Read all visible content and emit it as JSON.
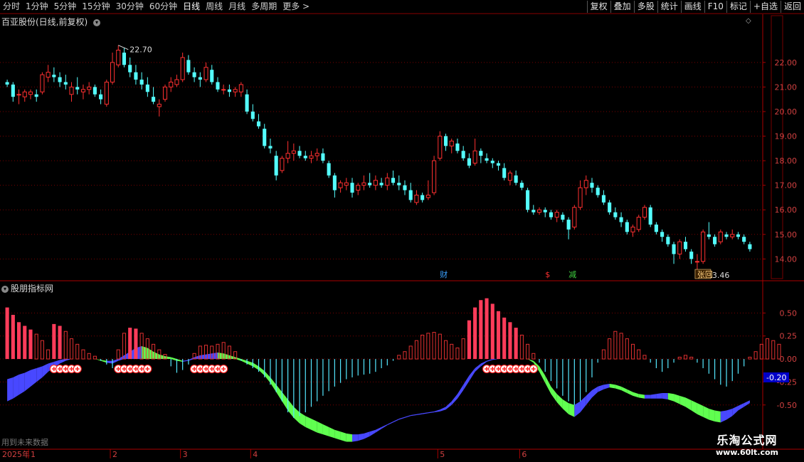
{
  "toolbar": {
    "periods": [
      "分时",
      "1分钟",
      "5分钟",
      "15分钟",
      "30分钟",
      "60分钟",
      "日线",
      "周线",
      "月线",
      "多周期",
      "更多 >"
    ],
    "active_period": "日线",
    "tools": [
      "复权",
      "叠加",
      "多股",
      "统计",
      "画线",
      "F10",
      "标记",
      "+自选",
      "返回"
    ]
  },
  "main_pane": {
    "title": "百亚股份(日线,前复权)",
    "high_label": "22.70",
    "low_label": "13.46",
    "markers": [
      {
        "text": "财",
        "color": "#3aa0ff"
      },
      {
        "text": "$",
        "color": "#ff3030"
      },
      {
        "text": "减",
        "color": "#40d040"
      },
      {
        "text": "张回",
        "color": "#ffd080"
      }
    ],
    "y_ticks": [
      "22.00",
      "21.00",
      "20.00",
      "19.00",
      "18.00",
      "17.00",
      "16.00",
      "15.00",
      "14.00"
    ]
  },
  "indicator_pane": {
    "title": "股朋指标网",
    "y_ticks": [
      "0.50",
      "0.25",
      "0.00",
      "-0.25",
      "-0.50"
    ],
    "current_value": "-0.20",
    "footer_note": "用到未来数据"
  },
  "x_axis": {
    "labels": [
      "2025年",
      "1",
      "2",
      "3",
      "4",
      "5",
      "6"
    ]
  },
  "watermark": {
    "line1": "乐淘公式网",
    "line2": "www.60lt.com"
  },
  "colors": {
    "up": "#ff3030",
    "down": "#54ffff",
    "hist_pos": "#ff3c5a",
    "hist_neg": "#54e8ff",
    "band_blue": "#4848ff",
    "band_green": "#60ff50"
  },
  "chart_data": {
    "type": "candlestick",
    "ylim": [
      13.2,
      23.5
    ],
    "candles": [
      [
        21.2,
        21.3,
        21.0,
        21.1
      ],
      [
        21.1,
        21.2,
        20.4,
        20.6
      ],
      [
        20.7,
        20.9,
        20.3,
        20.7
      ],
      [
        20.6,
        20.9,
        20.4,
        20.8
      ],
      [
        20.7,
        20.9,
        20.5,
        20.8
      ],
      [
        20.7,
        20.9,
        20.4,
        20.6
      ],
      [
        20.8,
        21.6,
        20.7,
        21.5
      ],
      [
        21.4,
        21.9,
        21.2,
        21.6
      ],
      [
        21.5,
        21.8,
        21.2,
        21.4
      ],
      [
        21.4,
        21.6,
        21.0,
        21.2
      ],
      [
        21.2,
        21.5,
        20.9,
        21.1
      ],
      [
        20.7,
        21.2,
        20.4,
        21.0
      ],
      [
        21.0,
        21.4,
        20.7,
        20.9
      ],
      [
        20.8,
        21.1,
        20.5,
        20.9
      ],
      [
        20.9,
        21.2,
        20.7,
        21.0
      ],
      [
        21.0,
        21.1,
        20.6,
        20.7
      ],
      [
        20.7,
        20.9,
        20.3,
        20.5
      ],
      [
        20.3,
        21.3,
        20.2,
        21.2
      ],
      [
        21.2,
        22.4,
        21.1,
        22.0
      ],
      [
        21.9,
        22.7,
        21.8,
        22.5
      ],
      [
        22.4,
        22.6,
        21.8,
        21.9
      ],
      [
        21.9,
        22.2,
        21.4,
        21.6
      ],
      [
        21.6,
        21.9,
        21.1,
        21.3
      ],
      [
        21.3,
        21.6,
        20.9,
        21.1
      ],
      [
        21.1,
        21.4,
        20.6,
        20.8
      ],
      [
        20.6,
        21.0,
        20.3,
        20.4
      ],
      [
        20.2,
        20.5,
        19.8,
        20.3
      ],
      [
        20.5,
        21.1,
        20.4,
        21.0
      ],
      [
        21.0,
        21.4,
        20.8,
        21.2
      ],
      [
        21.1,
        21.5,
        21.0,
        21.3
      ],
      [
        21.3,
        22.4,
        21.2,
        22.2
      ],
      [
        22.1,
        22.3,
        21.5,
        21.6
      ],
      [
        21.6,
        21.8,
        21.2,
        21.4
      ],
      [
        21.4,
        21.6,
        21.0,
        21.3
      ],
      [
        21.3,
        22.0,
        21.2,
        21.8
      ],
      [
        21.7,
        21.9,
        21.1,
        21.2
      ],
      [
        21.2,
        21.4,
        20.8,
        20.9
      ],
      [
        20.9,
        21.1,
        20.7,
        20.9
      ],
      [
        20.9,
        21.1,
        20.6,
        20.8
      ],
      [
        20.8,
        21.0,
        20.6,
        20.9
      ],
      [
        20.8,
        21.2,
        20.6,
        21.1
      ],
      [
        20.7,
        20.9,
        19.9,
        20.0
      ],
      [
        20.0,
        20.3,
        19.6,
        19.7
      ],
      [
        19.6,
        19.9,
        19.3,
        19.4
      ],
      [
        19.3,
        19.5,
        18.5,
        18.6
      ],
      [
        18.6,
        18.9,
        18.3,
        18.5
      ],
      [
        18.2,
        18.4,
        17.2,
        17.4
      ],
      [
        17.6,
        18.2,
        17.5,
        18.1
      ],
      [
        18.1,
        18.8,
        17.9,
        18.3
      ],
      [
        18.3,
        18.7,
        18.0,
        18.4
      ],
      [
        18.4,
        18.6,
        18.1,
        18.2
      ],
      [
        18.2,
        18.4,
        18.0,
        18.1
      ],
      [
        18.1,
        18.4,
        17.9,
        18.2
      ],
      [
        18.2,
        18.5,
        18.0,
        18.3
      ],
      [
        18.3,
        18.5,
        17.9,
        18.0
      ],
      [
        17.9,
        18.0,
        17.3,
        17.4
      ],
      [
        17.4,
        17.5,
        16.5,
        16.8
      ],
      [
        16.9,
        17.2,
        16.7,
        17.1
      ],
      [
        17.0,
        17.3,
        16.8,
        17.1
      ],
      [
        17.1,
        17.3,
        16.5,
        16.7
      ],
      [
        16.8,
        17.1,
        16.6,
        17.0
      ],
      [
        17.0,
        17.4,
        16.8,
        17.1
      ],
      [
        17.1,
        17.5,
        16.9,
        17.0
      ],
      [
        17.0,
        17.4,
        16.8,
        17.2
      ],
      [
        17.1,
        17.3,
        16.9,
        17.0
      ],
      [
        17.0,
        17.5,
        16.8,
        17.3
      ],
      [
        17.3,
        17.6,
        17.0,
        17.1
      ],
      [
        17.1,
        17.4,
        16.8,
        17.0
      ],
      [
        17.0,
        17.2,
        16.6,
        16.8
      ],
      [
        16.8,
        17.1,
        16.3,
        16.4
      ],
      [
        16.3,
        16.8,
        16.2,
        16.6
      ],
      [
        16.6,
        16.7,
        16.3,
        16.4
      ],
      [
        16.5,
        17.2,
        16.4,
        16.6
      ],
      [
        16.7,
        18.2,
        16.6,
        18.0
      ],
      [
        18.1,
        19.2,
        18.0,
        19.0
      ],
      [
        19.0,
        19.1,
        18.4,
        18.6
      ],
      [
        18.6,
        18.9,
        18.3,
        18.8
      ],
      [
        18.7,
        18.9,
        18.3,
        18.4
      ],
      [
        18.4,
        18.6,
        18.0,
        18.1
      ],
      [
        18.1,
        18.3,
        17.7,
        17.8
      ],
      [
        17.9,
        18.9,
        17.8,
        18.4
      ],
      [
        18.4,
        18.5,
        17.9,
        18.2
      ],
      [
        18.1,
        18.3,
        17.9,
        18.0
      ],
      [
        18.0,
        18.1,
        17.7,
        17.9
      ],
      [
        17.9,
        18.0,
        17.6,
        17.8
      ],
      [
        17.7,
        17.9,
        17.2,
        17.3
      ],
      [
        17.2,
        17.6,
        17.0,
        17.5
      ],
      [
        17.4,
        17.6,
        17.0,
        17.1
      ],
      [
        17.1,
        17.2,
        16.8,
        16.9
      ],
      [
        16.8,
        16.9,
        15.9,
        16.0
      ],
      [
        16.0,
        16.2,
        15.8,
        15.9
      ],
      [
        15.9,
        16.1,
        15.8,
        16.0
      ],
      [
        16.0,
        16.1,
        15.7,
        15.9
      ],
      [
        15.9,
        16.0,
        15.6,
        15.7
      ],
      [
        15.7,
        16.0,
        15.5,
        15.9
      ],
      [
        15.8,
        15.9,
        15.5,
        15.6
      ],
      [
        15.6,
        15.7,
        14.8,
        15.2
      ],
      [
        15.3,
        16.2,
        15.2,
        16.1
      ],
      [
        16.1,
        17.2,
        16.0,
        16.9
      ],
      [
        16.9,
        17.4,
        16.6,
        17.2
      ],
      [
        17.1,
        17.3,
        16.7,
        16.9
      ],
      [
        16.9,
        17.0,
        16.5,
        16.6
      ],
      [
        16.6,
        16.8,
        16.2,
        16.3
      ],
      [
        16.3,
        16.4,
        15.8,
        15.9
      ],
      [
        15.9,
        16.1,
        15.6,
        15.7
      ],
      [
        15.7,
        15.9,
        15.3,
        15.5
      ],
      [
        15.5,
        15.6,
        15.0,
        15.1
      ],
      [
        15.1,
        15.4,
        14.9,
        15.3
      ],
      [
        15.2,
        15.8,
        15.1,
        15.7
      ],
      [
        15.7,
        16.2,
        15.6,
        16.1
      ],
      [
        16.1,
        16.2,
        15.3,
        15.4
      ],
      [
        15.4,
        15.5,
        15.0,
        15.1
      ],
      [
        15.1,
        15.2,
        14.7,
        14.9
      ],
      [
        14.9,
        15.0,
        14.5,
        14.6
      ],
      [
        14.6,
        14.7,
        13.8,
        14.2
      ],
      [
        14.2,
        14.8,
        14.0,
        14.7
      ],
      [
        14.7,
        14.9,
        14.3,
        14.4
      ],
      [
        14.3,
        14.4,
        13.8,
        14.0
      ],
      [
        13.9,
        14.2,
        13.46,
        13.9
      ],
      [
        13.9,
        15.2,
        13.8,
        15.1
      ],
      [
        15.0,
        15.5,
        14.8,
        14.9
      ],
      [
        14.9,
        15.0,
        14.5,
        14.6
      ],
      [
        14.7,
        15.2,
        14.6,
        15.1
      ],
      [
        15.0,
        15.1,
        14.8,
        14.9
      ],
      [
        14.9,
        15.2,
        14.8,
        15.0
      ],
      [
        15.0,
        15.1,
        14.8,
        14.9
      ],
      [
        14.9,
        15.0,
        14.6,
        14.7
      ],
      [
        14.6,
        14.7,
        14.3,
        14.4
      ]
    ],
    "indicator": {
      "histogram": [
        0.56,
        0.48,
        0.4,
        0.36,
        0.32,
        0.27,
        0.2,
        0.1,
        0.38,
        0.36,
        0.3,
        0.22,
        0.16,
        0.1,
        0.06,
        0.03,
        -0.02,
        -0.06,
        -0.1,
        0.1,
        0.28,
        0.34,
        0.33,
        0.28,
        0.22,
        0.16,
        0.1,
        0.05,
        -0.08,
        -0.15,
        -0.12,
        -0.06,
        0.06,
        0.14,
        0.15,
        0.14,
        0.16,
        0.18,
        0.14,
        0.08,
        -0.02,
        -0.06,
        -0.1,
        -0.14,
        -0.2,
        -0.28,
        -0.36,
        -0.46,
        -0.58,
        -0.64,
        -0.62,
        -0.58,
        -0.52,
        -0.46,
        -0.4,
        -0.35,
        -0.3,
        -0.26,
        -0.22,
        -0.2,
        -0.18,
        -0.17,
        -0.16,
        -0.14,
        -0.1,
        -0.07,
        -0.02,
        0.04,
        0.08,
        0.14,
        0.2,
        0.26,
        0.28,
        0.29,
        0.27,
        0.2,
        0.16,
        0.12,
        0.22,
        0.42,
        0.56,
        0.64,
        0.66,
        0.6,
        0.52,
        0.45,
        0.4,
        0.34,
        0.26,
        0.16,
        0.06,
        -0.04,
        -0.14,
        -0.24,
        -0.32,
        -0.4,
        -0.46,
        -0.5,
        -0.46,
        -0.36,
        -0.2,
        -0.04,
        0.1,
        0.22,
        0.3,
        0.28,
        0.22,
        0.16,
        0.1,
        0.04,
        -0.04,
        -0.1,
        -0.14,
        -0.1,
        -0.04,
        0.02,
        0.04,
        0.02,
        -0.04,
        -0.1,
        -0.16,
        -0.22,
        -0.28,
        -0.3,
        -0.24,
        -0.16,
        -0.08,
        0.02,
        0.08,
        0.16,
        0.22,
        0.2,
        0.16
      ],
      "band_upper": [
        -0.22,
        -0.2,
        -0.17,
        -0.15,
        -0.12,
        -0.1,
        -0.08,
        -0.05,
        -0.03,
        -0.01,
        0.0,
        0.0,
        0.0,
        0.0,
        0.0,
        0.0,
        -0.01,
        -0.02,
        -0.02,
        0.0,
        0.04,
        0.08,
        0.12,
        0.14,
        0.12,
        0.08,
        0.05,
        0.03,
        0.02,
        0.0,
        -0.02,
        -0.01,
        0.02,
        0.04,
        0.05,
        0.06,
        0.07,
        0.06,
        0.04,
        0.02,
        0.0,
        -0.02,
        -0.04,
        -0.08,
        -0.13,
        -0.2,
        -0.28,
        -0.36,
        -0.44,
        -0.52,
        -0.58,
        -0.62,
        -0.65,
        -0.68,
        -0.71,
        -0.74,
        -0.77,
        -0.79,
        -0.81,
        -0.82,
        -0.82,
        -0.81,
        -0.79,
        -0.77,
        -0.74,
        -0.71,
        -0.68,
        -0.65,
        -0.63,
        -0.61,
        -0.6,
        -0.59,
        -0.58,
        -0.57,
        -0.55,
        -0.52,
        -0.46,
        -0.38,
        -0.28,
        -0.18,
        -0.1,
        -0.05,
        -0.02,
        0.0,
        0.0,
        0.0,
        0.0,
        0.0,
        0.0,
        0.0,
        -0.02,
        -0.08,
        -0.18,
        -0.3,
        -0.38,
        -0.44,
        -0.48,
        -0.5,
        -0.46,
        -0.4,
        -0.34,
        -0.3,
        -0.28,
        -0.27,
        -0.28,
        -0.3,
        -0.33,
        -0.36,
        -0.38,
        -0.39,
        -0.39,
        -0.38,
        -0.37,
        -0.37,
        -0.38,
        -0.4,
        -0.42,
        -0.45,
        -0.48,
        -0.51,
        -0.54,
        -0.56,
        -0.57,
        -0.56,
        -0.54,
        -0.51,
        -0.48,
        -0.45,
        -0.43,
        -0.42,
        -0.41,
        -0.4,
        -0.4
      ],
      "band_lower": [
        -0.46,
        -0.43,
        -0.39,
        -0.35,
        -0.3,
        -0.25,
        -0.2,
        -0.14,
        -0.09,
        -0.05,
        -0.02,
        0.0,
        0.0,
        0.0,
        0.0,
        0.0,
        -0.02,
        -0.04,
        -0.05,
        -0.02,
        0.0,
        0.0,
        0.0,
        0.0,
        0.0,
        0.0,
        0.0,
        0.0,
        0.0,
        -0.02,
        -0.03,
        -0.02,
        0.0,
        0.0,
        0.0,
        0.0,
        0.0,
        0.0,
        0.0,
        0.0,
        -0.02,
        -0.05,
        -0.08,
        -0.12,
        -0.18,
        -0.26,
        -0.36,
        -0.46,
        -0.56,
        -0.64,
        -0.7,
        -0.74,
        -0.77,
        -0.8,
        -0.82,
        -0.84,
        -0.86,
        -0.88,
        -0.9,
        -0.9,
        -0.89,
        -0.87,
        -0.84,
        -0.8,
        -0.76,
        -0.72,
        -0.69,
        -0.66,
        -0.64,
        -0.62,
        -0.61,
        -0.6,
        -0.59,
        -0.58,
        -0.57,
        -0.55,
        -0.5,
        -0.43,
        -0.34,
        -0.24,
        -0.14,
        -0.08,
        -0.03,
        -0.01,
        0.0,
        0.0,
        0.0,
        0.0,
        0.0,
        0.0,
        -0.04,
        -0.14,
        -0.26,
        -0.38,
        -0.47,
        -0.54,
        -0.6,
        -0.63,
        -0.58,
        -0.5,
        -0.42,
        -0.36,
        -0.33,
        -0.31,
        -0.32,
        -0.34,
        -0.37,
        -0.4,
        -0.42,
        -0.43,
        -0.43,
        -0.43,
        -0.43,
        -0.44,
        -0.46,
        -0.49,
        -0.52,
        -0.56,
        -0.6,
        -0.63,
        -0.66,
        -0.68,
        -0.69,
        -0.66,
        -0.62,
        -0.56,
        -0.52,
        -0.48,
        -0.46,
        -0.44,
        -0.43,
        -0.42,
        -0.41
      ],
      "plus_marker_groups": [
        {
          "start": 8,
          "count": 5
        },
        {
          "start": 19,
          "count": 6
        },
        {
          "start": 32,
          "count": 6
        },
        {
          "start": 82,
          "count": 9
        }
      ],
      "ylim": [
        -0.95,
        0.75
      ]
    }
  }
}
